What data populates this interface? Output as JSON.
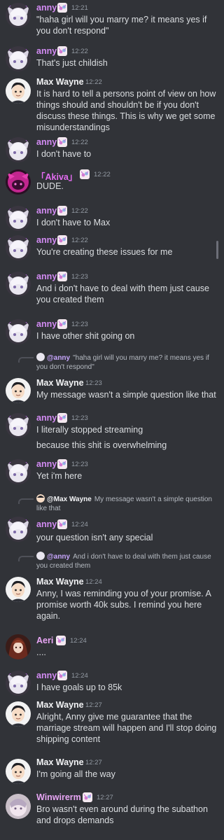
{
  "colors": {
    "background": "#313338",
    "anny": "#d48cf5",
    "max": "#f2f3f5",
    "akiva": "#e46df2",
    "text": "#dbdee1",
    "timestamp": "#949ba4"
  },
  "messages": [
    {
      "author": "anny",
      "time": "12:21",
      "text": "\"haha girl will you marry me? it means yes if you don't respond\""
    },
    {
      "author": "anny",
      "time": "12:22",
      "text": "That's just childish"
    },
    {
      "author": "Max Wayne",
      "time": "12:22",
      "text": "It is hard to tell a persons point of view on how things should and shouldn't be if you don't discuss these things. This is why we get some misunderstandings"
    },
    {
      "author": "anny",
      "time": "12:22",
      "text": "I don't have to"
    },
    {
      "author": "「Akiva」",
      "time": "12:22",
      "text": "DUDE."
    },
    {
      "author": "anny",
      "time": "12:22",
      "text": "I don't have to Max"
    },
    {
      "author": "anny",
      "time": "12:22",
      "text": "You're creating these issues for me"
    },
    {
      "author": "anny",
      "time": "12:23",
      "text": "And i don't have to deal with them just cause you created them"
    },
    {
      "author": "anny",
      "time": "12:23",
      "text": "I have other shit going on"
    },
    {
      "author": "Max Wayne",
      "time": "12:23",
      "text": "My message wasn't a simple question like that",
      "reply": {
        "name": "@anny",
        "text": "\"haha girl will you marry me? it means yes if you don't respond\""
      }
    },
    {
      "author": "anny",
      "time": "12:23",
      "text": "I literally stopped streaming",
      "text2": "because this shit is overwhelming"
    },
    {
      "author": "anny",
      "time": "12:23",
      "text": "Yet i'm here"
    },
    {
      "author": "anny",
      "time": "12:24",
      "text": "your question isn't any special",
      "reply": {
        "name": "@Max Wayne",
        "text": "My message wasn't a simple question like that"
      }
    },
    {
      "author": "Max Wayne",
      "time": "12:24",
      "text": "Anny, I was reminding you of your promise. A promise worth 40k subs. I remind you here again.",
      "reply": {
        "name": "@anny",
        "text": "And i don't have to deal with them just cause you created them"
      }
    },
    {
      "author": "Aeri",
      "time": "12:24",
      "text": "...."
    },
    {
      "author": "anny",
      "time": "12:24",
      "text": "I have goals up to 85k"
    },
    {
      "author": "Max Wayne",
      "time": "12:27",
      "text": "Alright, Anny give me guarantee that the marriage stream will happen and I'll stop doing shipping content"
    },
    {
      "author": "Max Wayne",
      "time": "12:27",
      "text": "I'm going all the way"
    },
    {
      "author": "Winwirerm",
      "time": "12:27",
      "text": "Bro wasn't even around during the subathon and drops demands"
    }
  ]
}
